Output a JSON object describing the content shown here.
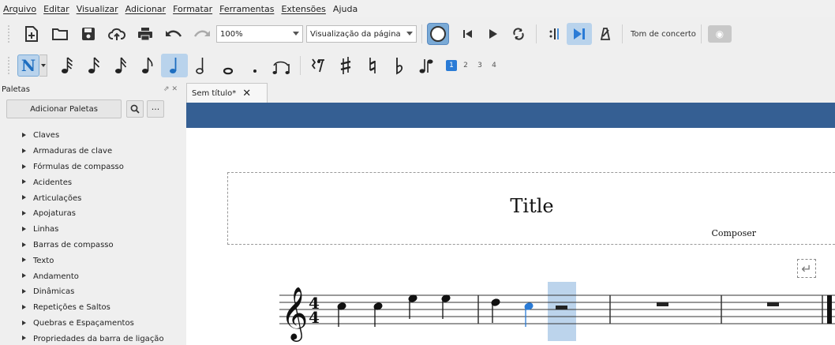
{
  "menu": [
    "Arquivo",
    "Editar",
    "Visualizar",
    "Adicionar",
    "Formatar",
    "Ferramentas",
    "Extensões",
    "Ajuda"
  ],
  "toolbar": {
    "zoom": "100%",
    "view_mode": "Visualização da página",
    "concert_pitch": "Tom de concerto"
  },
  "note_input": {
    "mode_label": "N",
    "voices": [
      "1",
      "2",
      "3",
      "4"
    ],
    "active_voice": "1"
  },
  "palettes": {
    "header": "Paletas",
    "add_button": "Adicionar Paletas",
    "items": [
      "Claves",
      "Armaduras de clave",
      "Fórmulas de compasso",
      "Acidentes",
      "Articulações",
      "Apojaturas",
      "Linhas",
      "Barras de compasso",
      "Texto",
      "Andamento",
      "Dinâmicas",
      "Repetições e Saltos",
      "Quebras e Espaçamentos",
      "Propriedades da barra de ligação"
    ]
  },
  "score": {
    "tab_title": "Sem título*",
    "title": "Title",
    "composer": "Composer",
    "time_signature": [
      "4",
      "4"
    ]
  },
  "colors": {
    "accent": "#2a7bd6",
    "selection": "#b9d3ec",
    "header_bar": "#355f93"
  }
}
